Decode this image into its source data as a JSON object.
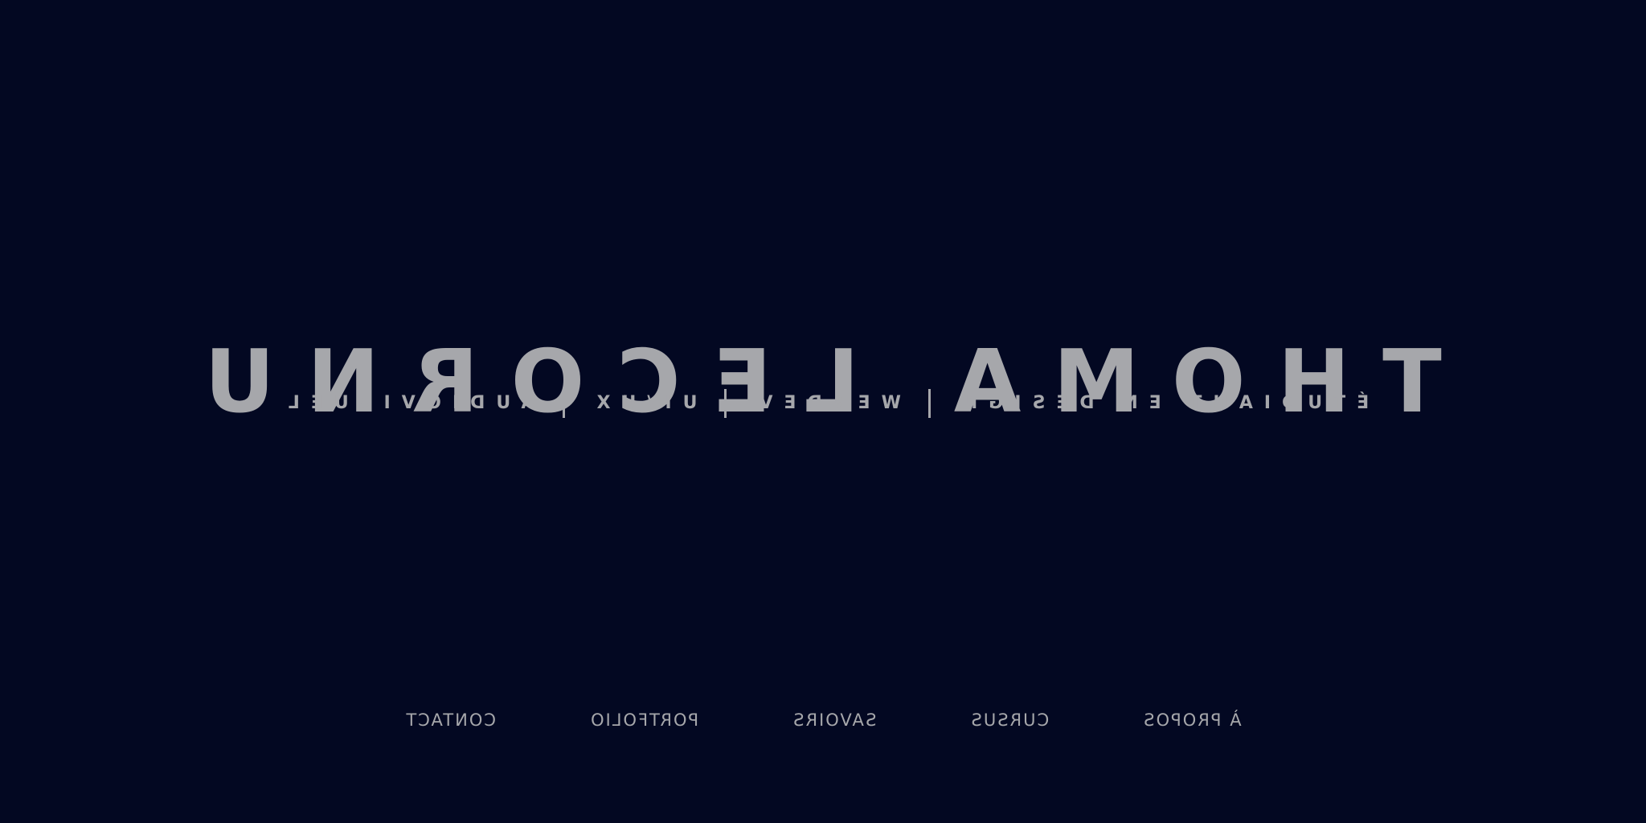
{
  "hero": {
    "name": "THOMA LECORNU",
    "tagline": [
      "ÉTUDIANT EN DESIGN",
      "WEBDEV",
      "UI/UX",
      "AUDIOVISUEL"
    ]
  },
  "nav": {
    "items": [
      "À PROPOS",
      "CURSUS",
      "SAVOIRS",
      "PORTFOLIO",
      "CONTACT"
    ]
  },
  "colors": {
    "background": "#030822",
    "text": "#a6a7ab"
  }
}
